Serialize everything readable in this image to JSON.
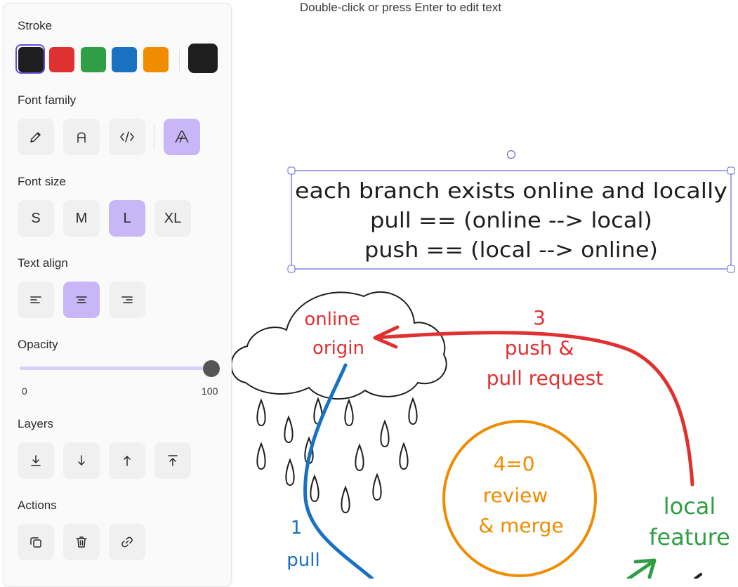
{
  "hint": "Double-click or press Enter to edit text",
  "panel": {
    "stroke_label": "Stroke",
    "colors": [
      {
        "name": "black",
        "hex": "#1e1e1e"
      },
      {
        "name": "red",
        "hex": "#e03131"
      },
      {
        "name": "green",
        "hex": "#2f9e44"
      },
      {
        "name": "blue",
        "hex": "#1971c2"
      },
      {
        "name": "orange",
        "hex": "#f08c00"
      }
    ],
    "selected_color": "#1e1e1e",
    "font_family_label": "Font family",
    "font_family_options": [
      "hand-drawn",
      "normal",
      "code",
      "custom"
    ],
    "font_family_selected": "custom",
    "font_size_label": "Font size",
    "font_sizes": [
      "S",
      "M",
      "L",
      "XL"
    ],
    "font_size_selected": "L",
    "text_align_label": "Text align",
    "text_align_selected": "center",
    "opacity_label": "Opacity",
    "opacity_min": "0",
    "opacity_max": "100",
    "opacity_value": 100,
    "layers_label": "Layers",
    "actions_label": "Actions"
  },
  "canvas": {
    "text_box": {
      "lines": [
        "each branch exists online and locally",
        "pull == (online --> local)",
        "push == (local --> online)"
      ]
    },
    "cloud_label": [
      "online",
      "origin"
    ],
    "step3": [
      "3",
      "push &",
      "pull request"
    ],
    "step4": [
      "4=0",
      "review",
      "& merge"
    ],
    "step1": [
      "1",
      "pull"
    ],
    "local_label": [
      "local",
      "feature"
    ],
    "colors": {
      "red": "#e03131",
      "blue": "#1971c2",
      "orange": "#f08c00",
      "green": "#2f9e44",
      "selection": "#6965db"
    }
  }
}
